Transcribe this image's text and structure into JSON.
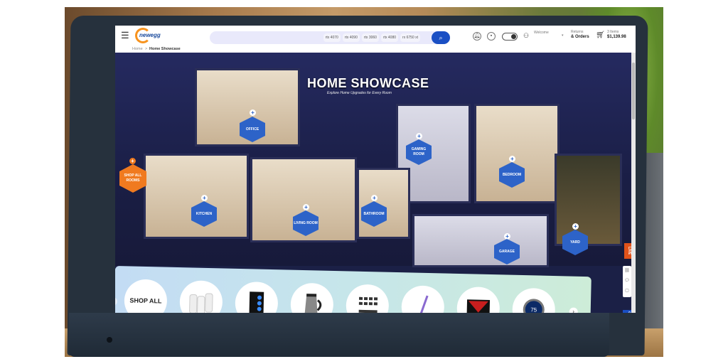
{
  "header": {
    "logo_text": "newegg",
    "search_placeholder": "",
    "search_chips": [
      "rtx 4070",
      "rtx 4090",
      "rtx 3060",
      "rtx 4080",
      "rx 6750 xt"
    ],
    "welcome_label": "Welcome",
    "returns_label": "Returns",
    "orders_label": "& Orders",
    "cart_items": "3 Items",
    "cart_total": "$1,139.98"
  },
  "breadcrumb": {
    "home": "Home",
    "separator": ">",
    "current": "Home Showcase"
  },
  "hero": {
    "title": "HOME SHOWCASE",
    "subtitle": "Explore Home Upgrades for Every Room",
    "shop_all_rooms": "SHOP ALL ROOMS",
    "rooms": [
      {
        "label": "OFFICE"
      },
      {
        "label": "GAMING ROOM"
      },
      {
        "label": "BEDROOM"
      },
      {
        "label": "KITCHEN"
      },
      {
        "label": "LIVING ROOM"
      },
      {
        "label": "BATHROOM"
      },
      {
        "label": "GARAGE"
      },
      {
        "label": "YARD"
      }
    ]
  },
  "side_widgets": {
    "live_label": "LIVE",
    "compare_label": "COMPARE"
  },
  "carousel": {
    "shop_all_label": "SHOP ALL",
    "items": [
      {
        "name": "mesh-wifi-system"
      },
      {
        "name": "gaming-pc-tower"
      },
      {
        "name": "coffee-carafe"
      },
      {
        "name": "security-camera-system"
      },
      {
        "name": "cordless-stick-vacuum"
      },
      {
        "name": "gaming-monitor"
      },
      {
        "name": "smart-thermostat",
        "display": "75"
      }
    ]
  },
  "colors": {
    "brand_blue": "#1a4fc4",
    "room_hex_blue": "#2d63c8",
    "accent_orange": "#f07a1f",
    "live_red": "#e0521a"
  }
}
